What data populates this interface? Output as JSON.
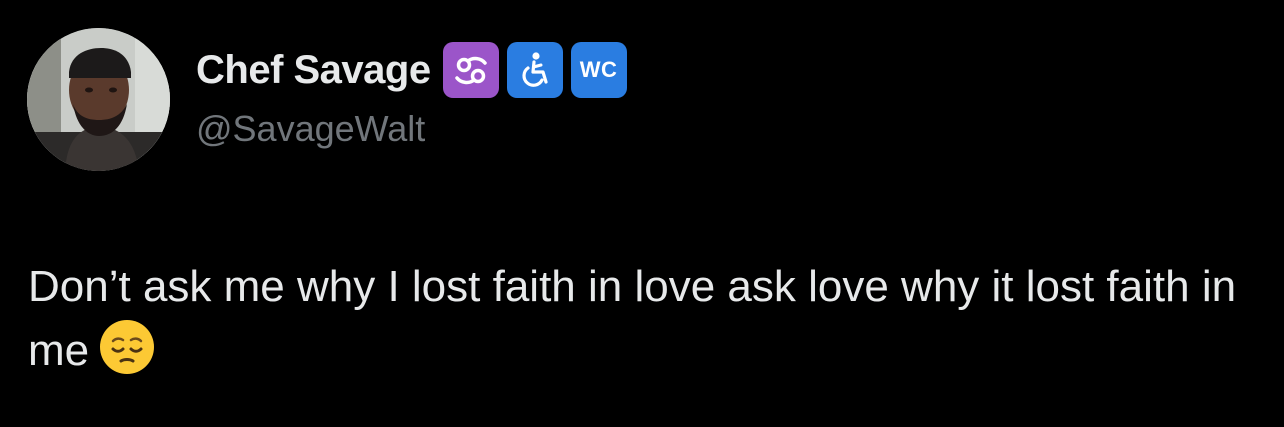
{
  "tweet": {
    "display_name": "Chef Savage",
    "handle": "@SavageWalt",
    "badges": [
      {
        "icon": "cancer-zodiac-icon"
      },
      {
        "icon": "wheelchair-accessibility-icon"
      },
      {
        "icon": "wc-restroom-icon",
        "text": "WC"
      }
    ],
    "text": "Don’t ask me why I lost faith in love ask love why it lost faith in me",
    "trailing_emoji": "pensive-face-emoji"
  },
  "colors": {
    "background": "#000000",
    "primary_text": "#e7e9ea",
    "secondary_text": "#71767b",
    "cancer_badge": "#9b55c9",
    "blue_badge": "#2a7de1"
  }
}
